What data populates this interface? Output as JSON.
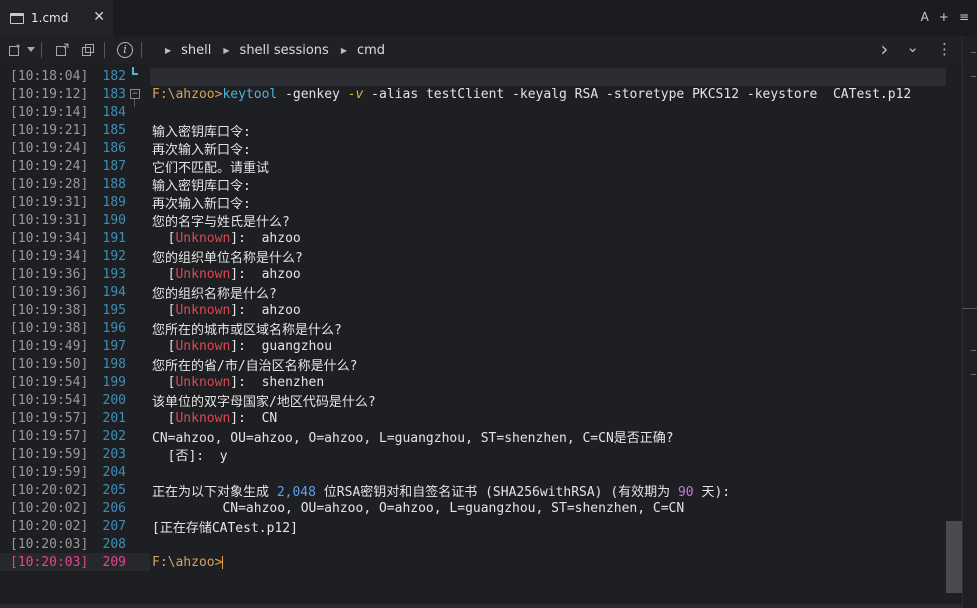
{
  "tab": {
    "title": "1.cmd",
    "close_glyph": "✕",
    "actions": [
      "A",
      "+",
      "≡"
    ]
  },
  "toolbar": {
    "breadcrumbs": [
      "shell",
      "shell sessions",
      "cmd"
    ],
    "right_controls": [
      "›",
      "⌄",
      "⋮"
    ],
    "icons": [
      "new-tab-icon",
      "dropdown-icon",
      "split-icon",
      "duplicate-icon",
      "info-icon"
    ]
  },
  "terminal": {
    "rows": [
      {
        "ts": "[10:18:04]",
        "ln": "182",
        "segments": []
      },
      {
        "ts": "[10:19:12]",
        "ln": "183",
        "fold": true,
        "segments": [
          {
            "t": "F:\\ahzoo>",
            "c": "c-prompt"
          },
          {
            "t": "keytool",
            "c": "c-cmd"
          },
          {
            "t": " -genkey ",
            "c": ""
          },
          {
            "t": "-v",
            "c": "c-flag-v"
          },
          {
            "t": " -alias testClient -keyalg RSA -storetype PKCS12 -keystore  CATest.p12",
            "c": ""
          }
        ]
      },
      {
        "ts": "[10:19:14]",
        "ln": "184",
        "segments": []
      },
      {
        "ts": "[10:19:21]",
        "ln": "185",
        "segments": [
          {
            "t": "输入密钥库口令:",
            "c": ""
          }
        ]
      },
      {
        "ts": "[10:19:24]",
        "ln": "186",
        "segments": [
          {
            "t": "再次输入新口令:",
            "c": ""
          }
        ]
      },
      {
        "ts": "[10:19:24]",
        "ln": "187",
        "segments": [
          {
            "t": "它们不匹配。请重试",
            "c": ""
          }
        ]
      },
      {
        "ts": "[10:19:28]",
        "ln": "188",
        "segments": [
          {
            "t": "输入密钥库口令:",
            "c": ""
          }
        ]
      },
      {
        "ts": "[10:19:31]",
        "ln": "189",
        "segments": [
          {
            "t": "再次输入新口令:",
            "c": ""
          }
        ]
      },
      {
        "ts": "[10:19:31]",
        "ln": "190",
        "segments": [
          {
            "t": "您的名字与姓氏是什么?",
            "c": ""
          }
        ]
      },
      {
        "ts": "[10:19:34]",
        "ln": "191",
        "segments": [
          {
            "t": "  [",
            "c": ""
          },
          {
            "t": "Unknown",
            "c": "c-err"
          },
          {
            "t": "]:  ahzoo",
            "c": ""
          }
        ]
      },
      {
        "ts": "[10:19:34]",
        "ln": "192",
        "segments": [
          {
            "t": "您的组织单位名称是什么?",
            "c": ""
          }
        ]
      },
      {
        "ts": "[10:19:36]",
        "ln": "193",
        "segments": [
          {
            "t": "  [",
            "c": ""
          },
          {
            "t": "Unknown",
            "c": "c-err"
          },
          {
            "t": "]:  ahzoo",
            "c": ""
          }
        ]
      },
      {
        "ts": "[10:19:36]",
        "ln": "194",
        "segments": [
          {
            "t": "您的组织名称是什么?",
            "c": ""
          }
        ]
      },
      {
        "ts": "[10:19:38]",
        "ln": "195",
        "segments": [
          {
            "t": "  [",
            "c": ""
          },
          {
            "t": "Unknown",
            "c": "c-err"
          },
          {
            "t": "]:  ahzoo",
            "c": ""
          }
        ]
      },
      {
        "ts": "[10:19:38]",
        "ln": "196",
        "segments": [
          {
            "t": "您所在的城市或区域名称是什么?",
            "c": ""
          }
        ]
      },
      {
        "ts": "[10:19:49]",
        "ln": "197",
        "segments": [
          {
            "t": "  [",
            "c": ""
          },
          {
            "t": "Unknown",
            "c": "c-err"
          },
          {
            "t": "]:  guangzhou",
            "c": ""
          }
        ]
      },
      {
        "ts": "[10:19:50]",
        "ln": "198",
        "segments": [
          {
            "t": "您所在的省/市/自治区名称是什么?",
            "c": ""
          }
        ]
      },
      {
        "ts": "[10:19:54]",
        "ln": "199",
        "segments": [
          {
            "t": "  [",
            "c": ""
          },
          {
            "t": "Unknown",
            "c": "c-err"
          },
          {
            "t": "]:  shenzhen",
            "c": ""
          }
        ]
      },
      {
        "ts": "[10:19:54]",
        "ln": "200",
        "segments": [
          {
            "t": "该单位的双字母国家/地区代码是什么?",
            "c": ""
          }
        ]
      },
      {
        "ts": "[10:19:57]",
        "ln": "201",
        "segments": [
          {
            "t": "  [",
            "c": ""
          },
          {
            "t": "Unknown",
            "c": "c-err"
          },
          {
            "t": "]:  CN",
            "c": ""
          }
        ]
      },
      {
        "ts": "[10:19:57]",
        "ln": "202",
        "segments": [
          {
            "t": "CN=ahzoo, OU=ahzoo, O=ahzoo, L=guangzhou, ST=shenzhen, C=CN是否正确?",
            "c": ""
          }
        ]
      },
      {
        "ts": "[10:19:59]",
        "ln": "203",
        "segments": [
          {
            "t": "  [否]:  y",
            "c": ""
          }
        ]
      },
      {
        "ts": "[10:19:59]",
        "ln": "204",
        "segments": []
      },
      {
        "ts": "[10:20:02]",
        "ln": "205",
        "segments": [
          {
            "t": "正在为以下对象生成 ",
            "c": ""
          },
          {
            "t": "2,048",
            "c": "c-num"
          },
          {
            "t": " 位RSA密钥对和自签名证书 (SHA256withRSA) (有效期为 ",
            "c": ""
          },
          {
            "t": "90",
            "c": "c-num2"
          },
          {
            "t": " 天):",
            "c": ""
          }
        ]
      },
      {
        "ts": "[10:20:02]",
        "ln": "206",
        "segments": [
          {
            "t": "         CN=ahzoo, OU=ahzoo, O=ahzoo, L=guangzhou, ST=shenzhen, C=CN",
            "c": ""
          }
        ]
      },
      {
        "ts": "[10:20:02]",
        "ln": "207",
        "segments": [
          {
            "t": "[正在存储CATest.p12]",
            "c": ""
          }
        ]
      },
      {
        "ts": "[10:20:03]",
        "ln": "208",
        "segments": []
      },
      {
        "ts": "[10:20:03]",
        "ln": "209",
        "current": true,
        "segments": [
          {
            "t": "F:\\ahzoo>",
            "c": "c-prompt"
          }
        ]
      }
    ]
  },
  "colors": {
    "background": "#1e1f22",
    "timestamp": "#9a9a9a",
    "line_number": "#3d8fb8",
    "prompt": "#d6a35a",
    "command": "#4fb4d8",
    "error": "#e0454f",
    "current_line": "#e0468d"
  }
}
